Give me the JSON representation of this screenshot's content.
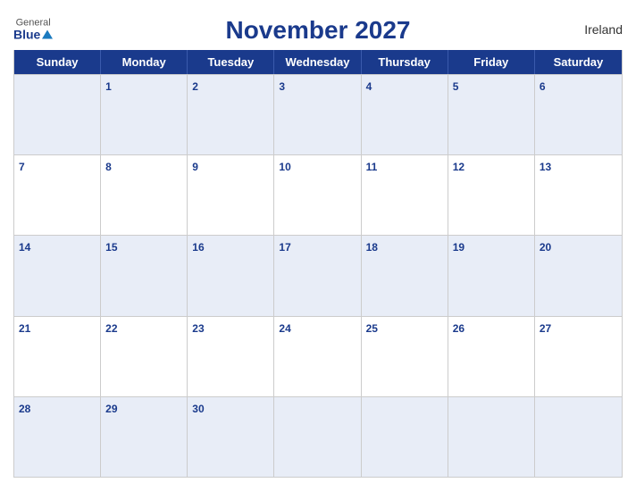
{
  "header": {
    "title": "November 2027",
    "country": "Ireland",
    "logo": {
      "general": "General",
      "blue": "Blue"
    }
  },
  "calendar": {
    "day_headers": [
      "Sunday",
      "Monday",
      "Tuesday",
      "Wednesday",
      "Thursday",
      "Friday",
      "Saturday"
    ],
    "weeks": [
      [
        {
          "date": null
        },
        {
          "date": "1"
        },
        {
          "date": "2"
        },
        {
          "date": "3"
        },
        {
          "date": "4"
        },
        {
          "date": "5"
        },
        {
          "date": "6"
        }
      ],
      [
        {
          "date": "7"
        },
        {
          "date": "8"
        },
        {
          "date": "9"
        },
        {
          "date": "10"
        },
        {
          "date": "11"
        },
        {
          "date": "12"
        },
        {
          "date": "13"
        }
      ],
      [
        {
          "date": "14"
        },
        {
          "date": "15"
        },
        {
          "date": "16"
        },
        {
          "date": "17"
        },
        {
          "date": "18"
        },
        {
          "date": "19"
        },
        {
          "date": "20"
        }
      ],
      [
        {
          "date": "21"
        },
        {
          "date": "22"
        },
        {
          "date": "23"
        },
        {
          "date": "24"
        },
        {
          "date": "25"
        },
        {
          "date": "26"
        },
        {
          "date": "27"
        }
      ],
      [
        {
          "date": "28"
        },
        {
          "date": "29"
        },
        {
          "date": "30"
        },
        {
          "date": null
        },
        {
          "date": null
        },
        {
          "date": null
        },
        {
          "date": null
        }
      ]
    ]
  }
}
